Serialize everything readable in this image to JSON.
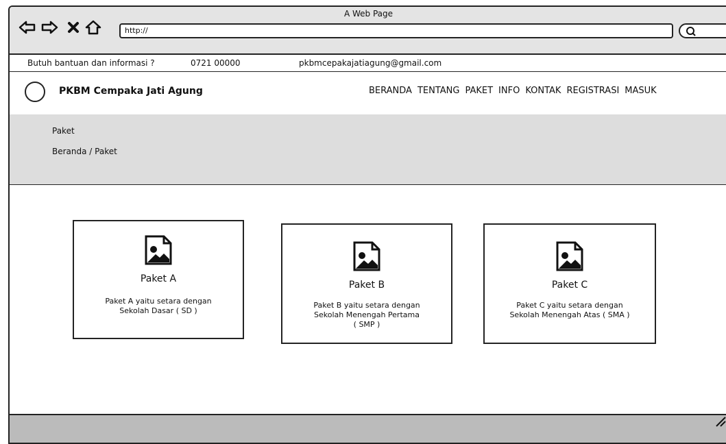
{
  "browser": {
    "page_title": "A Web Page",
    "url": "http://"
  },
  "infobar": {
    "help_text": "Butuh bantuan dan informasi ?",
    "phone": "0721 00000",
    "email": "pkbmcepakajatiagung@gmail.com"
  },
  "header": {
    "brand": "PKBM Cempaka Jati Agung",
    "menu": [
      "BERANDA",
      "TENTANG",
      "PAKET",
      "INFO",
      "KONTAK",
      "REGISTRASI",
      "MASUK"
    ]
  },
  "banner": {
    "title": "Paket",
    "breadcrumb": "Beranda / Paket"
  },
  "cards": [
    {
      "title": "Paket A",
      "desc1": "Paket A yaitu setara dengan",
      "desc2": "Sekolah Dasar ( SD )",
      "desc3": ""
    },
    {
      "title": "Paket B",
      "desc1": "Paket B yaitu setara dengan",
      "desc2": "Sekolah Menengah Pertama",
      "desc3": "( SMP )"
    },
    {
      "title": "Paket C",
      "desc1": "Paket C yaitu setara dengan",
      "desc2": "Sekolah Menengah Atas ( SMA )",
      "desc3": ""
    }
  ],
  "icons": {
    "back": "back-arrow-icon",
    "forward": "forward-arrow-icon",
    "stop": "close-icon",
    "home": "home-icon",
    "search": "search-icon",
    "card_image": "image-placeholder-icon"
  }
}
